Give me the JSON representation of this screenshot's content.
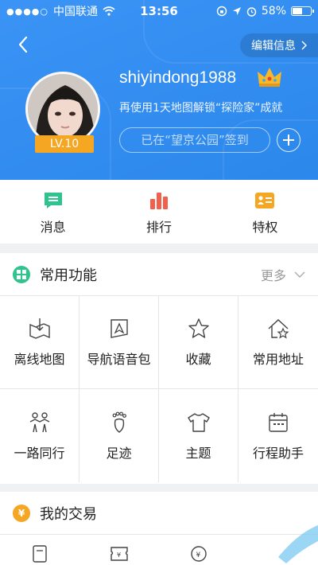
{
  "status_bar": {
    "carrier": "中国联通",
    "time": "13:56",
    "battery": "58%",
    "battery_level": 0.58
  },
  "header": {
    "edit_label": "编辑信息",
    "username": "shiyindong1988",
    "level": "LV.10",
    "subtitle": "再使用1天地图解锁“探险家”成就",
    "checkin": "已在“望京公园”签到"
  },
  "quick_actions": [
    {
      "label": "消息",
      "icon": "message-icon",
      "color": "#2fc48d"
    },
    {
      "label": "排行",
      "icon": "ranking-icon",
      "color": "#f2604c"
    },
    {
      "label": "特权",
      "icon": "privilege-icon",
      "color": "#f5a623"
    }
  ],
  "common": {
    "title": "常用功能",
    "more": "更多",
    "items": [
      {
        "label": "离线地图",
        "icon": "offline-map-icon"
      },
      {
        "label": "导航语音包",
        "icon": "voice-pack-icon"
      },
      {
        "label": "收藏",
        "icon": "star-icon"
      },
      {
        "label": "常用地址",
        "icon": "home-star-icon"
      },
      {
        "label": "一路同行",
        "icon": "companions-icon"
      },
      {
        "label": "足迹",
        "icon": "footprint-icon"
      },
      {
        "label": "主题",
        "icon": "tshirt-icon"
      },
      {
        "label": "行程助手",
        "icon": "calendar-icon"
      }
    ]
  },
  "trade": {
    "title": "我的交易"
  },
  "colors": {
    "header_blue": "#2e8df5",
    "level_badge": "#f5a623"
  }
}
